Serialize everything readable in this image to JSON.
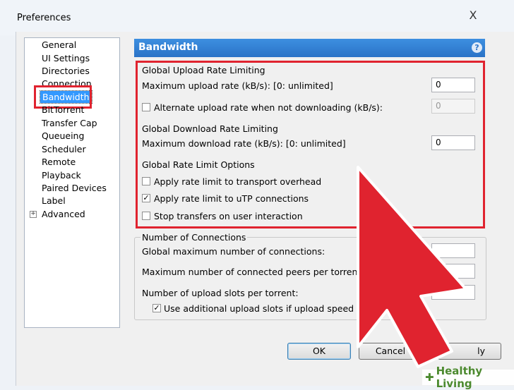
{
  "window": {
    "title": "Preferences",
    "close_glyph": "X"
  },
  "sidebar": {
    "items": [
      {
        "label": "General"
      },
      {
        "label": "UI Settings"
      },
      {
        "label": "Directories"
      },
      {
        "label": "Connection"
      },
      {
        "label": "Bandwidth"
      },
      {
        "label": "BitTorrent"
      },
      {
        "label": "Transfer Cap"
      },
      {
        "label": "Queueing"
      },
      {
        "label": "Scheduler"
      },
      {
        "label": "Remote"
      },
      {
        "label": "Playback"
      },
      {
        "label": "Paired Devices"
      },
      {
        "label": "Label"
      },
      {
        "label": "Advanced"
      }
    ],
    "selected": "Bandwidth",
    "expand_glyph": "+"
  },
  "panel": {
    "title": "Bandwidth",
    "help_glyph": "?",
    "upload": {
      "group_label": "Global Upload Rate Limiting",
      "max_label": "Maximum upload rate (kB/s): [0: unlimited]",
      "max_value": "0",
      "alt_label": "Alternate upload rate when not downloading (kB/s):",
      "alt_checked": false,
      "alt_value": "0"
    },
    "download": {
      "group_label": "Global Download Rate Limiting",
      "max_label": "Maximum download rate (kB/s): [0: unlimited]",
      "max_value": "0"
    },
    "limit_options": {
      "group_label": "Global Rate Limit Options",
      "transport_label": "Apply rate limit to transport overhead",
      "transport_checked": false,
      "utp_label": "Apply rate limit to uTP connections",
      "utp_checked": true,
      "stop_label": "Stop transfers on user interaction",
      "stop_checked": false
    },
    "connections": {
      "group_label": "Number of Connections",
      "global_label": "Global maximum number of connections:",
      "peers_label": "Maximum number of connected peers per torrent:",
      "slots_label": "Number of upload slots per torrent:",
      "additional_label": "Use additional upload slots if upload speed < 90%",
      "additional_checked": true
    }
  },
  "buttons": {
    "ok": "OK",
    "cancel": "Cancel",
    "apply": "ly"
  },
  "watermark": {
    "brand": "Healthy Living"
  },
  "colors": {
    "highlight_red": "#e0232f",
    "header_blue": "#2a73c7",
    "selection_blue": "#3399ff"
  }
}
